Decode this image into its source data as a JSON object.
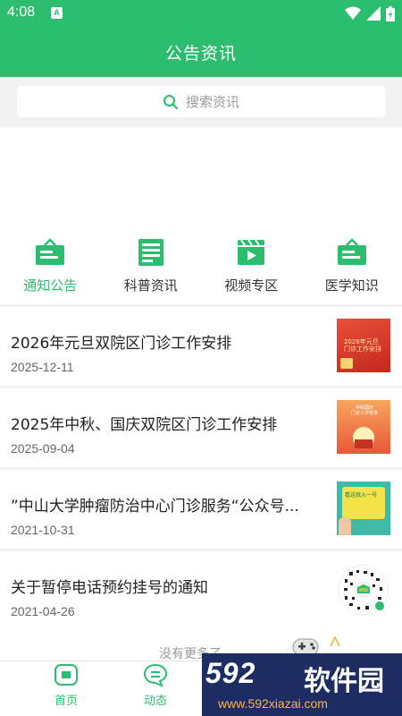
{
  "status": {
    "time": "4:08",
    "badge": "A"
  },
  "header": {
    "title": "公告资讯"
  },
  "search": {
    "placeholder": "搜索资讯"
  },
  "categories": [
    {
      "label": "通知公告",
      "icon": "notice-board-icon",
      "active": true
    },
    {
      "label": "科普资讯",
      "icon": "article-icon",
      "active": false
    },
    {
      "label": "视频专区",
      "icon": "video-icon",
      "active": false
    },
    {
      "label": "医学知识",
      "icon": "medical-board-icon",
      "active": false
    }
  ],
  "news": [
    {
      "title": "2026年元旦双院区门诊工作安排",
      "date": "2025-12-11",
      "thumb_text": "2026年元旦\n门诊工作安排"
    },
    {
      "title": "2025年中秋、国庆双院区门诊工作安排",
      "date": "2025-09-04",
      "thumb_text": "中秋国庆\n门诊工作安排"
    },
    {
      "title": "”中山大学肿瘤防治中心门诊服务“公众号...",
      "date": "2021-10-31",
      "thumb_text": "看这就入一号"
    },
    {
      "title": "关于暂停电话预约挂号的通知",
      "date": "2021-04-26",
      "thumb_text": ""
    }
  ],
  "list_footer": {
    "text": "没有更多了"
  },
  "tabbar": [
    {
      "label": "首页",
      "icon": "home-icon"
    },
    {
      "label": "动态",
      "icon": "chat-icon"
    }
  ],
  "watermark": {
    "brand_num": "592",
    "brand_cn": "软件园",
    "url": "www.592xiazai.com"
  },
  "colors": {
    "primary": "#2dbd6e",
    "background": "#f2f2f2"
  }
}
